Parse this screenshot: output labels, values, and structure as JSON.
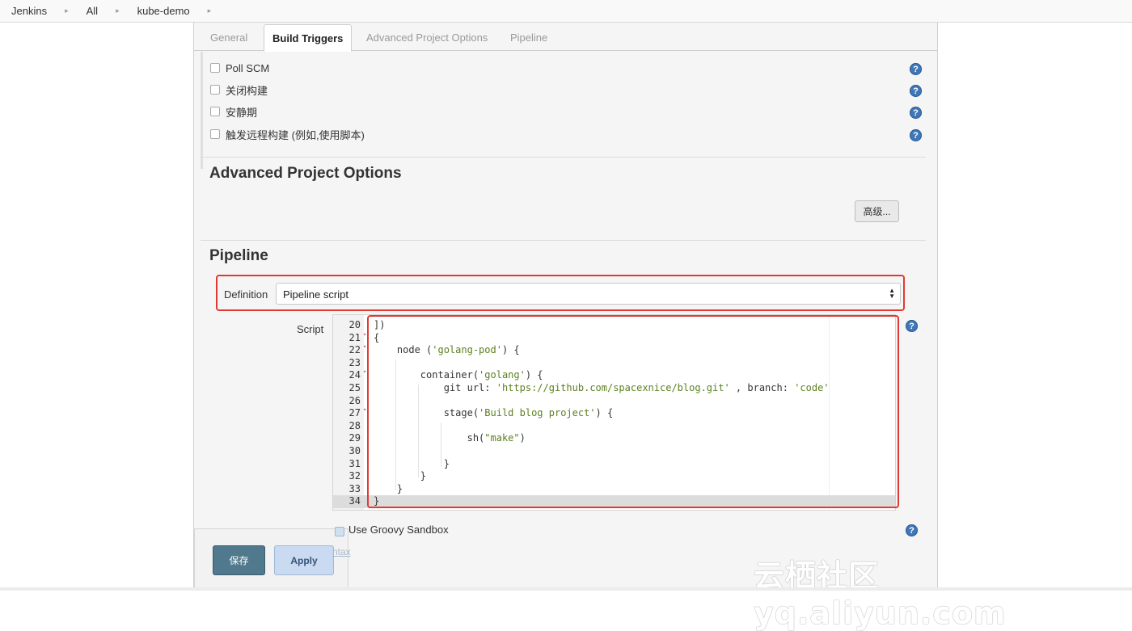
{
  "breadcrumb": {
    "items": [
      "Jenkins",
      "All",
      "kube-demo"
    ],
    "separator": "▸"
  },
  "tabs": [
    {
      "label": "General",
      "active": false
    },
    {
      "label": "Build Triggers",
      "active": true
    },
    {
      "label": "Advanced Project Options",
      "active": false
    },
    {
      "label": "Pipeline",
      "active": false
    }
  ],
  "triggers": {
    "items": [
      {
        "label": "Poll SCM",
        "checked": false
      },
      {
        "label": "关闭构建",
        "checked": false
      },
      {
        "label": "安静期",
        "checked": false
      },
      {
        "label": "触发远程构建 (例如,使用脚本)",
        "checked": false
      }
    ]
  },
  "advanced": {
    "title": "Advanced Project Options",
    "button_label": "高级..."
  },
  "pipeline": {
    "title": "Pipeline",
    "definition_label": "Definition",
    "definition_value": "Pipeline script",
    "script_label": "Script",
    "code_lines": [
      {
        "n": "20",
        "fold": "",
        "text": "])"
      },
      {
        "n": "21",
        "fold": "▾",
        "text": "{"
      },
      {
        "n": "22",
        "fold": "▾",
        "text": "    node ('golang-pod') {"
      },
      {
        "n": "23",
        "fold": "",
        "text": ""
      },
      {
        "n": "24",
        "fold": "▾",
        "text": "        container('golang') {"
      },
      {
        "n": "25",
        "fold": "",
        "text": "            git url: 'https://github.com/spacexnice/blog.git' , branch: 'code'"
      },
      {
        "n": "26",
        "fold": "",
        "text": ""
      },
      {
        "n": "27",
        "fold": "▾",
        "text": "            stage('Build blog project') {"
      },
      {
        "n": "28",
        "fold": "",
        "text": ""
      },
      {
        "n": "29",
        "fold": "",
        "text": "                sh(\"make\")"
      },
      {
        "n": "30",
        "fold": "",
        "text": ""
      },
      {
        "n": "31",
        "fold": "",
        "text": "            }"
      },
      {
        "n": "32",
        "fold": "",
        "text": "        }"
      },
      {
        "n": "33",
        "fold": "",
        "text": "    }"
      },
      {
        "n": "34",
        "fold": "",
        "text": "}"
      }
    ],
    "sandbox_label": "Use Groovy Sandbox",
    "sandbox_checked": true,
    "syntax_link": "ntax"
  },
  "actions": {
    "save_label": "保存",
    "apply_label": "Apply"
  },
  "help_glyph": "?",
  "watermark": "云栖社区 yq.aliyun.com",
  "colors": {
    "highlight_border": "#e03a33",
    "help_icon": "#3f77b8",
    "save_button": "#4b758b",
    "apply_button": "#c9daf0",
    "string_literal": "#5a7f1e"
  }
}
